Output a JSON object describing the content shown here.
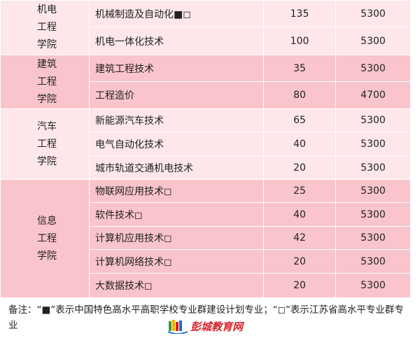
{
  "colleges": [
    {
      "name_lines": [
        "机电",
        "工程",
        "学院"
      ],
      "tone": "light",
      "majors": [
        {
          "major": "机械制造及自动化■◻",
          "plan": "135",
          "fee": "5300",
          "h": 38
        },
        {
          "major": "机电一体化技术",
          "plan": "100",
          "fee": "5300",
          "h": 40
        }
      ]
    },
    {
      "name_lines": [
        "建筑",
        "工程",
        "学院"
      ],
      "tone": "dark",
      "majors": [
        {
          "major": "建筑工程技术",
          "plan": "35",
          "fee": "5300",
          "h": 38
        },
        {
          "major": "工程造价",
          "plan": "80",
          "fee": "4700",
          "h": 39
        }
      ]
    },
    {
      "name_lines": [
        "汽车",
        "工程",
        "学院"
      ],
      "tone": "light",
      "majors": [
        {
          "major": "新能源汽车技术",
          "plan": "65",
          "fee": "5300",
          "h": 33
        },
        {
          "major": "电气自动化技术",
          "plan": "40",
          "fee": "5300",
          "h": 34
        },
        {
          "major": "城市轨道交通机电技术",
          "plan": "20",
          "fee": "5300",
          "h": 34
        }
      ]
    },
    {
      "name_lines": [
        "信息",
        "工程",
        "学院"
      ],
      "tone": "dark",
      "majors": [
        {
          "major": "物联网应用技术◻",
          "plan": "25",
          "fee": "5300",
          "h": 33
        },
        {
          "major": "软件技术◻",
          "plan": "40",
          "fee": "5300",
          "h": 34
        },
        {
          "major": "计算机应用技术◻",
          "plan": "42",
          "fee": "5300",
          "h": 33
        },
        {
          "major": "计算机网络技术◻",
          "plan": "20",
          "fee": "5300",
          "h": 34
        },
        {
          "major": "大数据技术◻",
          "plan": "20",
          "fee": "5300",
          "h": 35
        }
      ]
    }
  ],
  "note": "备注：“■”表示中国特色高水平高职学校专业群建设计划专业；“◻”表示江苏省高水平专业群专业",
  "logo": {
    "text": "彭城教育网",
    "icon": "book-logo-icon"
  },
  "colors": {
    "light_row": "#fde7ea",
    "dark_row": "#f9c4cb",
    "logo_red": "#d8232a"
  }
}
